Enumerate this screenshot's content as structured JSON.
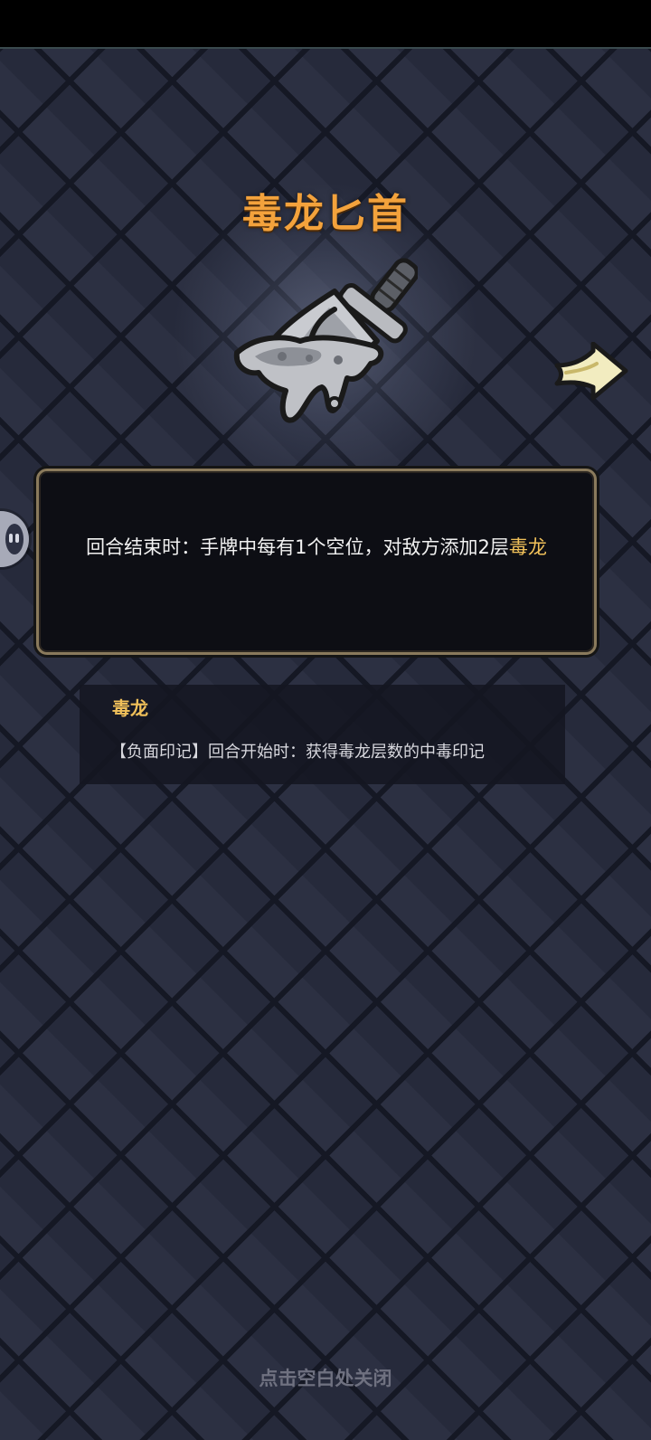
{
  "item": {
    "name": "毒龙匕首",
    "image_icon": "poison-dagger-icon",
    "description_main": "回合结束时：手牌中每有1个空位，对敌方添加2层",
    "description_keyword": "毒龙"
  },
  "navigation": {
    "next_icon": "right-arrow-icon",
    "side_handle_icon": "pause-handle-icon"
  },
  "keyword_info": {
    "title": "毒龙",
    "description": "【负面印记】回合开始时：获得毒龙层数的中毒印记"
  },
  "footer": {
    "close_hint": "点击空白处关闭"
  },
  "colors": {
    "title": "#f3a23c",
    "keyword": "#f1c15a",
    "background": "#272b3d"
  }
}
